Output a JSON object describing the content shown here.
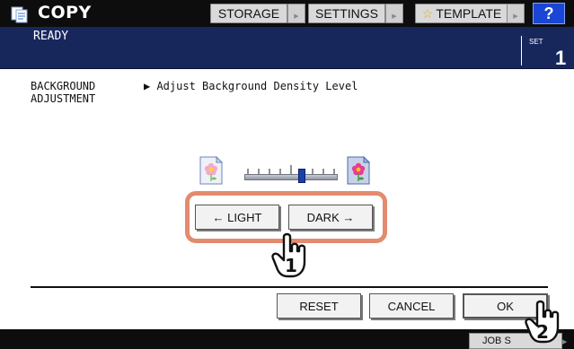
{
  "header": {
    "app_title": "COPY",
    "app_icon": "copier-icon",
    "storage_label": "STORAGE",
    "settings_label": "SETTINGS",
    "template_label": "TEMPLATE",
    "help_label": "?"
  },
  "status": {
    "message": "READY",
    "set_label": "SET",
    "set_count": "1"
  },
  "function": {
    "title_line1": "BACKGROUND",
    "title_line2": "ADJUSTMENT",
    "description": "▶ Adjust Background Density Level"
  },
  "density": {
    "light_label": "← LIGHT",
    "dark_label": "DARK →",
    "level_fraction": 0.62,
    "steps": 9,
    "light_icon": "flower-light-icon",
    "dark_icon": "flower-dark-icon"
  },
  "callouts": {
    "step1": "1",
    "step2": "2"
  },
  "actions": {
    "reset_label": "RESET",
    "cancel_label": "CANCEL",
    "ok_label": "OK"
  },
  "footer": {
    "job_status_label": "JOB S"
  },
  "colors": {
    "topbar": "#0d0d0d",
    "statusbar": "#17275c",
    "help_button": "#1a46d6",
    "highlight": "#e38b6f",
    "slider_knob": "#1a3fae"
  }
}
